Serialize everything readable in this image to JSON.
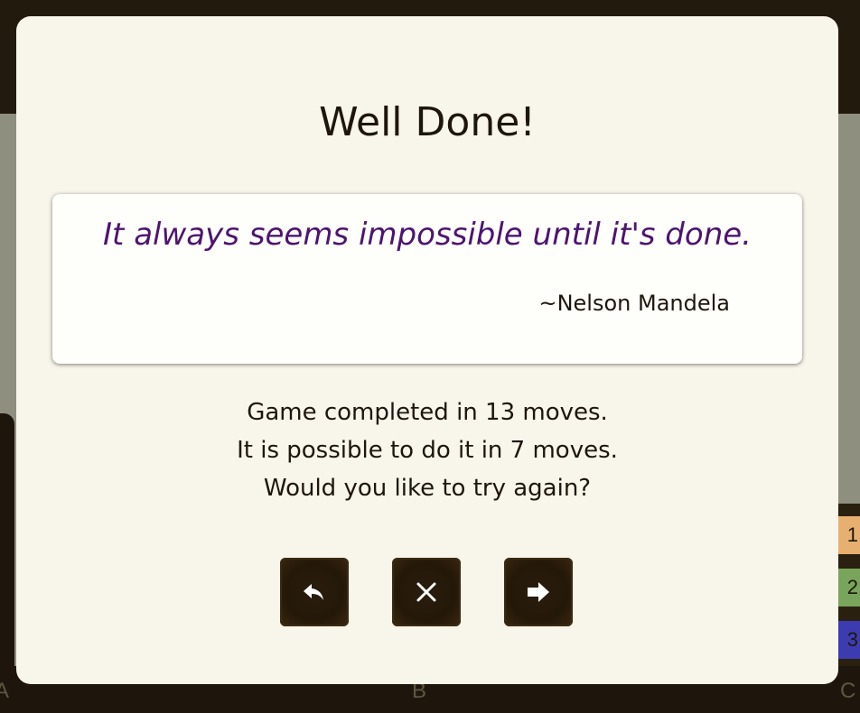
{
  "background": {
    "row_labels": [
      "1",
      "2",
      "3"
    ],
    "column_labels": [
      "A",
      "B",
      "C"
    ]
  },
  "modal": {
    "title": "Well Done!",
    "quote": {
      "text": "It always seems impossible until it's done.",
      "author": "~Nelson Mandela"
    },
    "message": {
      "line1": "Game completed in 13 moves.",
      "line2": "It is possible to do it in 7 moves.",
      "line3": "Would you like to try again?"
    },
    "buttons": [
      {
        "icon": "undo-icon"
      },
      {
        "icon": "close-icon"
      },
      {
        "icon": "arrow-right-icon"
      }
    ]
  },
  "colors": {
    "modal_bg": "#f8f5ea",
    "quote_text": "#4d1470",
    "button_bg": "#241808",
    "button_icon": "#ffffff"
  }
}
